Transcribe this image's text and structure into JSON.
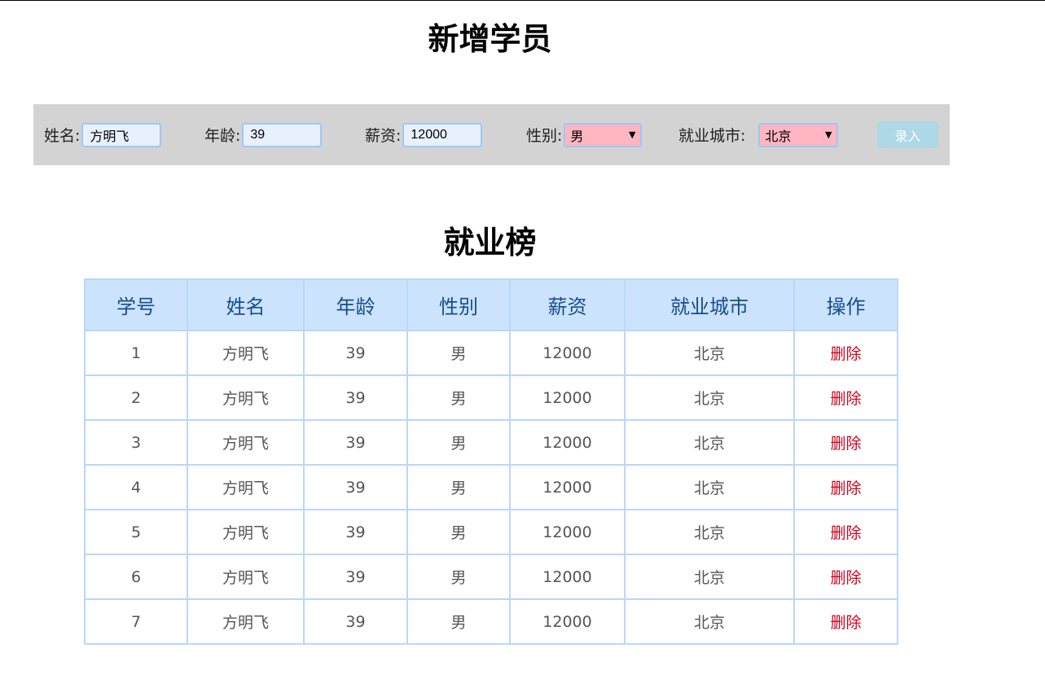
{
  "title_add": "新增学员",
  "title_rank": "就业榜",
  "form": {
    "name_label": "姓名:",
    "name_value": "方明飞",
    "age_label": "年龄:",
    "age_value": "39",
    "salary_label": "薪资:",
    "salary_value": "12000",
    "gender_label": "性别:",
    "gender_value": "男",
    "city_label": "就业城市:",
    "city_value": "北京",
    "submit_label": "录入"
  },
  "table": {
    "headers": [
      "学号",
      "姓名",
      "年龄",
      "性别",
      "薪资",
      "就业城市",
      "操作"
    ],
    "rows": [
      {
        "id": "1",
        "name": "方明飞",
        "age": "39",
        "gender": "男",
        "salary": "12000",
        "city": "北京",
        "op": "删除"
      },
      {
        "id": "2",
        "name": "方明飞",
        "age": "39",
        "gender": "男",
        "salary": "12000",
        "city": "北京",
        "op": "删除"
      },
      {
        "id": "3",
        "name": "方明飞",
        "age": "39",
        "gender": "男",
        "salary": "12000",
        "city": "北京",
        "op": "删除"
      },
      {
        "id": "4",
        "name": "方明飞",
        "age": "39",
        "gender": "男",
        "salary": "12000",
        "city": "北京",
        "op": "删除"
      },
      {
        "id": "5",
        "name": "方明飞",
        "age": "39",
        "gender": "男",
        "salary": "12000",
        "city": "北京",
        "op": "删除"
      },
      {
        "id": "6",
        "name": "方明飞",
        "age": "39",
        "gender": "男",
        "salary": "12000",
        "city": "北京",
        "op": "删除"
      },
      {
        "id": "7",
        "name": "方明飞",
        "age": "39",
        "gender": "男",
        "salary": "12000",
        "city": "北京",
        "op": "删除"
      }
    ]
  },
  "colors": {
    "form_bg": "#d3d3d3",
    "input_border": "#9cc8f4",
    "select_bg": "#ffb6c1",
    "button_bg": "#add8e6",
    "header_bg": "#cce3fe",
    "delete_color": "#d0021b"
  }
}
